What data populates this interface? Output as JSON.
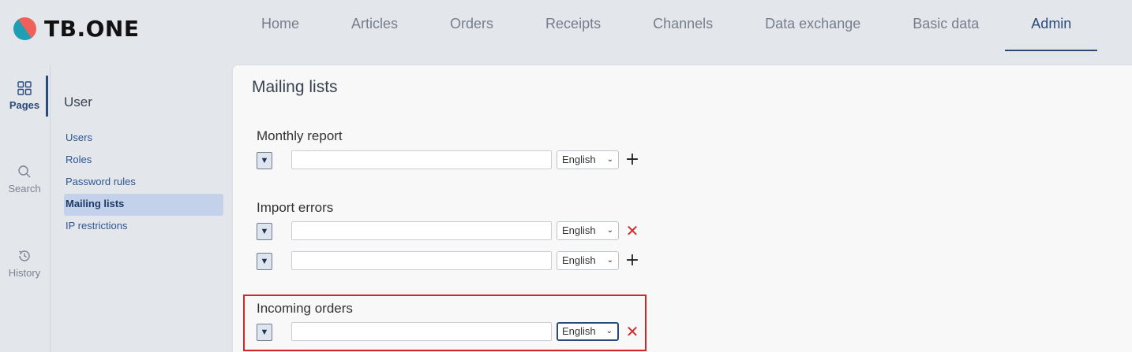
{
  "app": {
    "logo_text": "TB.ONE"
  },
  "topnav": [
    {
      "label": "Home"
    },
    {
      "label": "Articles"
    },
    {
      "label": "Orders"
    },
    {
      "label": "Receipts"
    },
    {
      "label": "Channels"
    },
    {
      "label": "Data exchange"
    },
    {
      "label": "Basic data"
    },
    {
      "label": "Admin",
      "active": true
    }
  ],
  "rail": {
    "pages": "Pages",
    "search": "Search",
    "history": "History"
  },
  "subside": {
    "title": "User",
    "items": [
      {
        "label": "Users"
      },
      {
        "label": "Roles"
      },
      {
        "label": "Password rules"
      },
      {
        "label": "Mailing lists",
        "active": true
      },
      {
        "label": "IP restrictions"
      }
    ]
  },
  "main": {
    "title": "Mailing lists",
    "groups": [
      {
        "title": "Monthly report",
        "rows": [
          {
            "email": "",
            "language": "English",
            "action": "add"
          }
        ]
      },
      {
        "title": "Import errors",
        "rows": [
          {
            "email": "",
            "language": "English",
            "action": "remove"
          },
          {
            "email": "",
            "language": "English",
            "action": "add"
          }
        ]
      },
      {
        "title": "Incoming orders",
        "rows": [
          {
            "email": "",
            "language": "English",
            "action": "remove"
          }
        ]
      }
    ]
  },
  "icons": {
    "expand": "▼",
    "add": "+",
    "remove": "✕",
    "chevron": "⌄"
  },
  "colors": {
    "accent": "#2a4a7a",
    "remove": "#d22c2c",
    "highlight": "#d4252b",
    "logo_teal": "#1e9fb3",
    "logo_coral": "#f0605a"
  }
}
